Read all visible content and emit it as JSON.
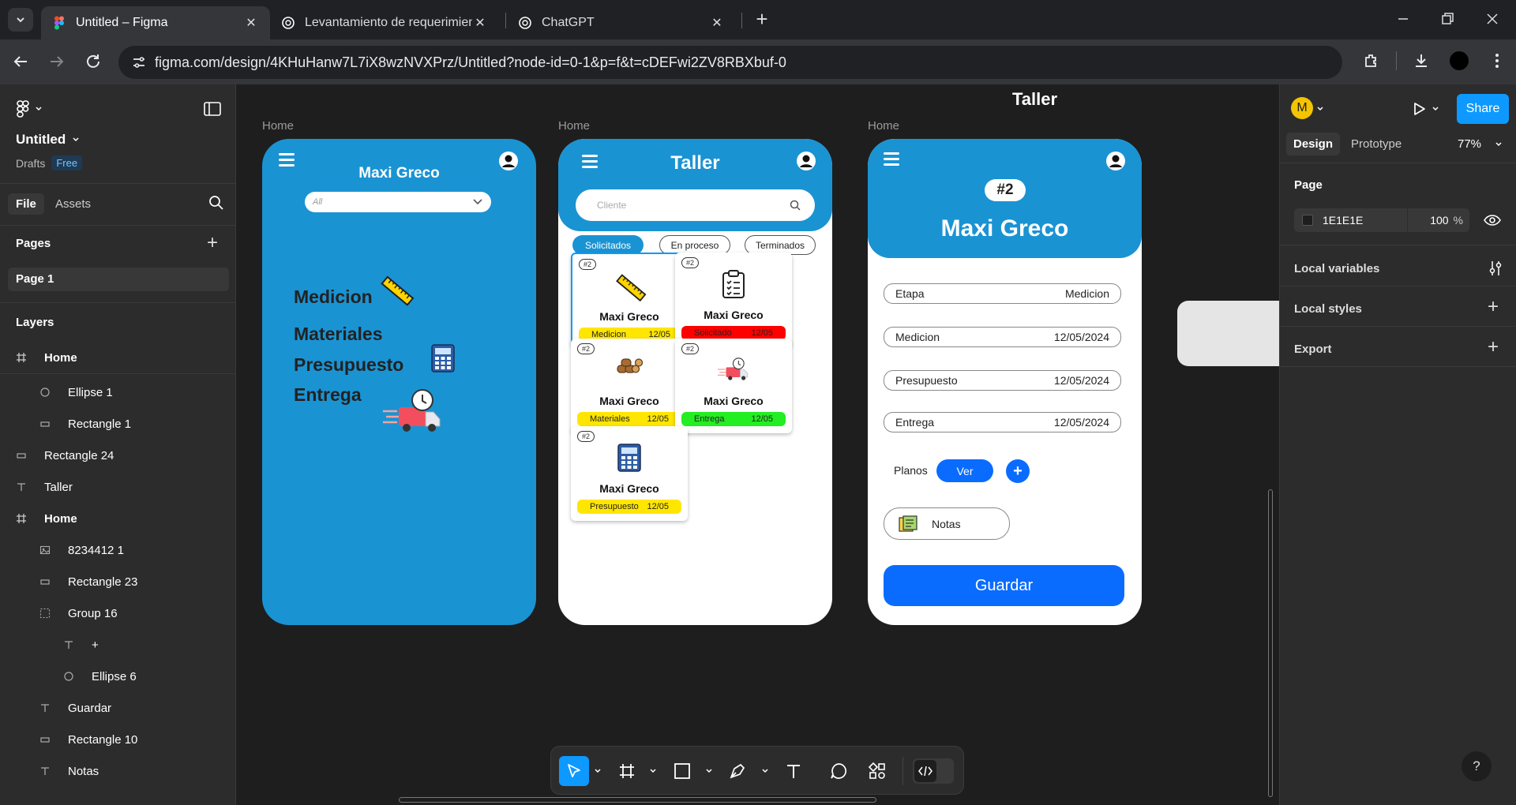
{
  "browser": {
    "tabs": [
      {
        "title": "Untitled – Figma",
        "active": true
      },
      {
        "title": "Levantamiento de requerimient",
        "active": false
      },
      {
        "title": "ChatGPT",
        "active": false
      }
    ],
    "url": "figma.com/design/4KHuHanw7L7iX8wzNVXPrz/Untitled?node-id=0-1&p=f&t=cDEFwi2ZV8RBXbuf-0"
  },
  "left_panel": {
    "file_name": "Untitled",
    "drafts": "Drafts",
    "plan_badge": "Free",
    "tab_file": "File",
    "tab_assets": "Assets",
    "pages_heading": "Pages",
    "page_item": "Page 1",
    "layers_heading": "Layers",
    "layers": [
      {
        "name": "Home",
        "icon": "frame-icon",
        "bold": true
      },
      {
        "name": "Ellipse 1",
        "icon": "ellipse-icon"
      },
      {
        "name": "Rectangle 1",
        "icon": "rectangle-icon"
      },
      {
        "name": "Rectangle 24",
        "icon": "rectangle-icon"
      },
      {
        "name": "Taller",
        "icon": "text-icon"
      },
      {
        "name": "Home",
        "icon": "frame-icon",
        "bold": true
      },
      {
        "name": "8234412 1",
        "icon": "image-icon"
      },
      {
        "name": "Rectangle 23",
        "icon": "rectangle-icon"
      },
      {
        "name": "Group 16",
        "icon": "group-icon"
      },
      {
        "name": "+",
        "icon": "text-icon"
      },
      {
        "name": "Ellipse 6",
        "icon": "ellipse-icon"
      },
      {
        "name": "Guardar",
        "icon": "text-icon"
      },
      {
        "name": "Rectangle 10",
        "icon": "rectangle-icon"
      },
      {
        "name": "Notas",
        "icon": "text-icon"
      }
    ]
  },
  "right_panel": {
    "avatar_letter": "M",
    "share_label": "Share",
    "tab_design": "Design",
    "tab_prototype": "Prototype",
    "zoom": "77%",
    "page_heading": "Page",
    "page_color": "1E1E1E",
    "page_opacity": "100",
    "percent_sign": "%",
    "local_variables": "Local variables",
    "local_styles": "Local styles",
    "export": "Export",
    "help": "?"
  },
  "canvas": {
    "floating_title": "Taller",
    "frame_labels": [
      "Home",
      "Home",
      "Home"
    ],
    "frame1": {
      "title": "Maxi Greco",
      "dropdown_value": "All",
      "menu": [
        "Medicion",
        "Materiales",
        "Presupuesto",
        "Entrega"
      ]
    },
    "frame2": {
      "title": "Taller",
      "search_placeholder": "Cliente",
      "filters": [
        "Solicitados",
        "En proceso",
        "Terminados"
      ],
      "cards": [
        {
          "badge": "#2",
          "name": "Maxi Greco",
          "status": "Medicion",
          "date": "12/05",
          "color": "#FFE600",
          "icon": "ruler-icon"
        },
        {
          "badge": "#2",
          "name": "Maxi Greco",
          "status": "Solicitado",
          "date": "12/05",
          "color": "#FF0000",
          "icon": "clipboard-icon"
        },
        {
          "badge": "#2",
          "name": "Maxi Greco",
          "status": "Materiales",
          "date": "12/05",
          "color": "#FFE600",
          "icon": "logs-icon"
        },
        {
          "badge": "#2",
          "name": "Maxi Greco",
          "status": "Entrega",
          "date": "12/05",
          "color": "#22EE22",
          "icon": "delivery-truck-icon"
        },
        {
          "badge": "#2",
          "name": "Maxi Greco",
          "status": "Presupuesto",
          "date": "12/05",
          "color": "#FFE600",
          "icon": "calculator-icon"
        }
      ]
    },
    "frame3": {
      "badge": "#2",
      "title": "Maxi Greco",
      "rows": [
        {
          "label": "Etapa",
          "value": "Medicion"
        },
        {
          "label": "Medicion",
          "value": "12/05/2024"
        },
        {
          "label": "Presupuesto",
          "value": "12/05/2024"
        },
        {
          "label": "Entrega",
          "value": "12/05/2024"
        }
      ],
      "planos_label": "Planos",
      "ver_label": "Ver",
      "plus_label": "+",
      "notas_label": "Notas",
      "guardar_label": "Guardar"
    }
  },
  "colors": {
    "accent_blue": "#0D99FF",
    "phone_blue": "#1A93D3",
    "button_blue": "#0A6CFF",
    "canvas_bg": "#1E1E1E"
  }
}
